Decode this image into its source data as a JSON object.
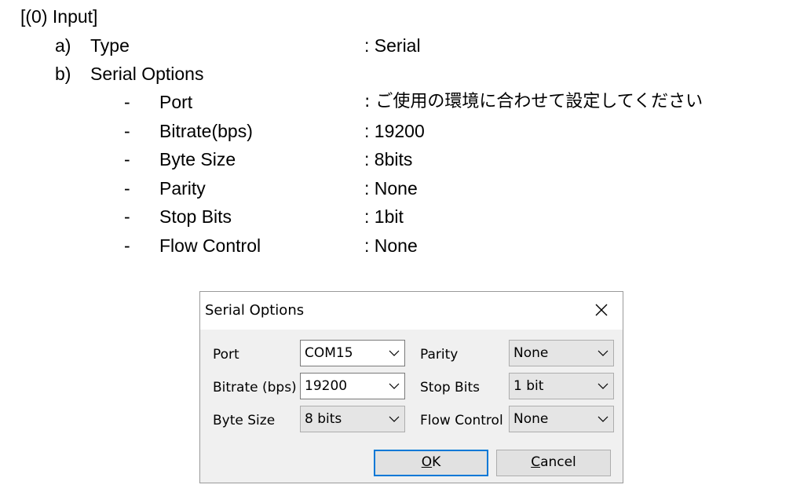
{
  "doc": {
    "heading": "[(0) Input]",
    "item_a": {
      "marker": "a)",
      "label": "Type",
      "value": ": Serial"
    },
    "item_b": {
      "marker": "b)",
      "label": "Serial Options"
    },
    "options": [
      {
        "dash": "-",
        "label": "Port",
        "value": ": ご使用の環境に合わせて設定してください"
      },
      {
        "dash": "-",
        "label": "Bitrate(bps)",
        "value": ": 19200"
      },
      {
        "dash": "-",
        "label": "Byte Size",
        "value": ": 8bits"
      },
      {
        "dash": "-",
        "label": "Parity",
        "value": ": None"
      },
      {
        "dash": "-",
        "label": "Stop Bits",
        "value": ": 1bit"
      },
      {
        "dash": "-",
        "label": "Flow Control",
        "value": ": None"
      }
    ]
  },
  "dialog": {
    "title": "Serial Options",
    "close_icon": "close-icon",
    "port": {
      "label": "Port",
      "value": "COM15"
    },
    "bitrate": {
      "label": "Bitrate (bps)",
      "value": "19200"
    },
    "bytesize": {
      "label": "Byte Size",
      "value": "8 bits"
    },
    "parity": {
      "label": "Parity",
      "value": "None"
    },
    "stopbits": {
      "label": "Stop Bits",
      "value": "1 bit"
    },
    "flow": {
      "label": "Flow Control",
      "value": "None"
    },
    "ok_mnemonic": "O",
    "ok_rest": "K",
    "cancel_mnemonic": "C",
    "cancel_rest": "ancel",
    "accent_color": "#0078d7"
  }
}
